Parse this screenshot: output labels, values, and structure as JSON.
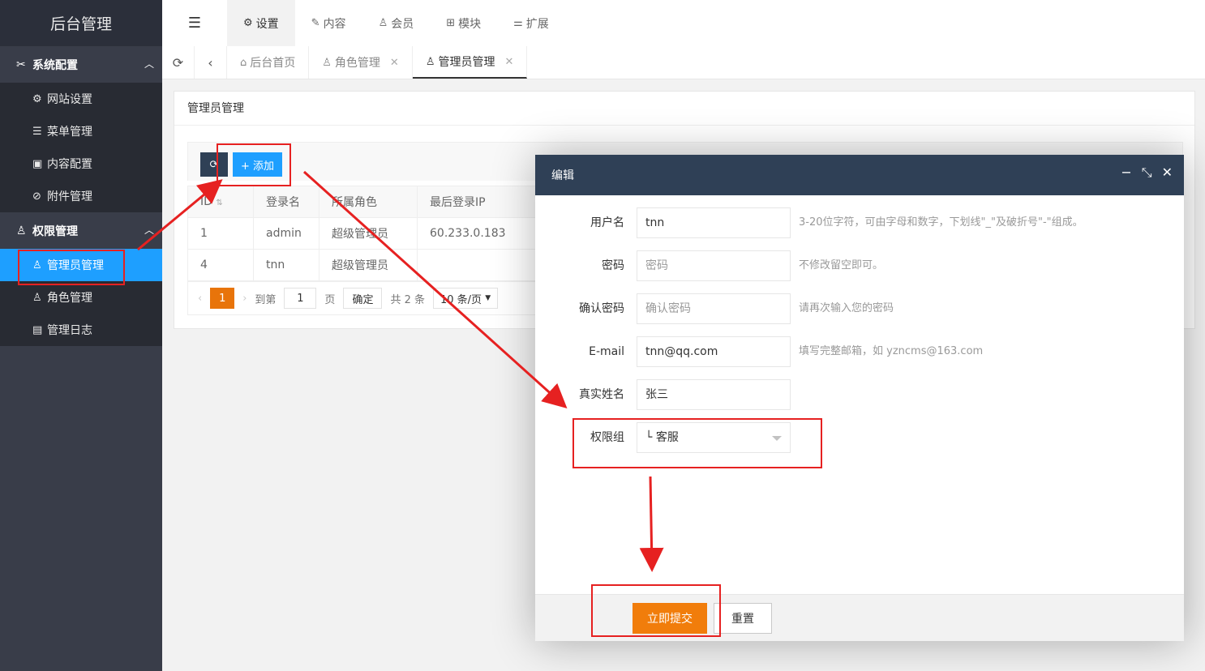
{
  "sidebar": {
    "logo": "后台管理",
    "groups": [
      {
        "title": "系统配置",
        "items": [
          "网站设置",
          "菜单管理",
          "内容配置",
          "附件管理"
        ]
      },
      {
        "title": "权限管理",
        "items": [
          "管理员管理",
          "角色管理",
          "管理日志"
        ]
      }
    ]
  },
  "topnav": {
    "items": [
      "设置",
      "内容",
      "会员",
      "模块",
      "扩展"
    ]
  },
  "tabs": {
    "items": [
      "后台首页",
      "角色管理",
      "管理员管理"
    ]
  },
  "panel": {
    "title": "管理员管理",
    "add_label": "+ 添加",
    "columns": [
      "ID",
      "登录名",
      "所属角色",
      "最后登录IP"
    ],
    "rows": [
      [
        "1",
        "admin",
        "超级管理员",
        "60.233.0.183"
      ],
      [
        "4",
        "tnn",
        "超级管理员",
        ""
      ]
    ],
    "pager": {
      "current": "1",
      "goto_label": "到第",
      "input": "1",
      "page_label": "页",
      "ok": "确定",
      "total": "共 2 条",
      "size": "10 条/页"
    }
  },
  "dialog": {
    "title": "编辑",
    "fields": [
      {
        "label": "用户名",
        "value": "tnn",
        "tip": "3-20位字符，可由字母和数字，下划线\"_\"及破折号\"-\"组成。"
      },
      {
        "label": "密码",
        "placeholder": "密码",
        "tip": "不修改留空即可。"
      },
      {
        "label": "确认密码",
        "placeholder": "确认密码",
        "tip": "请再次输入您的密码"
      },
      {
        "label": "E-mail",
        "value": "tnn@qq.com",
        "tip": "填写完整邮箱，如 yzncms@163.com"
      },
      {
        "label": "真实姓名",
        "value": "张三",
        "tip": ""
      },
      {
        "label": "权限组",
        "value": "└ 客服",
        "tip": ""
      }
    ],
    "submit": "立即提交",
    "reset": "重置"
  },
  "colors": {
    "sidebar_bg": "#393d49",
    "active_blue": "#1e9fff",
    "dialog_header": "#2f4056",
    "submit_orange": "#f17d0b",
    "annotation_red": "#e62121"
  }
}
